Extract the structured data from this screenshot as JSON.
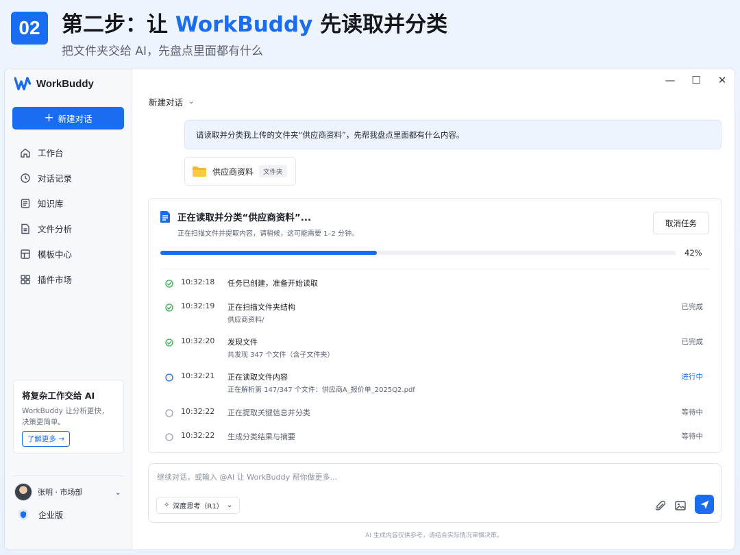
{
  "banner": {
    "step_number": "02",
    "title_prefix": "第二步：让 ",
    "title_brand": "WorkBuddy",
    "title_suffix": " 先读取并分类",
    "subtitle": "把文件夹交给 AI，先盘点里面都有什么"
  },
  "app": {
    "name": "WorkBuddy",
    "new_chat_label": "新建对话",
    "nav": [
      {
        "label": "工作台",
        "icon": "home-icon"
      },
      {
        "label": "对话记录",
        "icon": "clock-icon"
      },
      {
        "label": "知识库",
        "icon": "book-icon"
      },
      {
        "label": "文件分析",
        "icon": "file-icon"
      },
      {
        "label": "模板中心",
        "icon": "template-icon"
      },
      {
        "label": "插件市场",
        "icon": "grid-icon"
      }
    ],
    "promo": {
      "title": "将复杂工作交给 AI",
      "desc_line1": "WorkBuddy 让分析更快，",
      "desc_line2": "决策更简单。",
      "button": "了解更多 →"
    },
    "user": {
      "name": "张明 · 市场部"
    },
    "plan": "企业版"
  },
  "window_controls": {
    "minimize": "—",
    "maximize": "☐",
    "close": "✕"
  },
  "conversation": {
    "title": "新建对话",
    "user_message": "请读取并分类我上传的文件夹“供应商资料”，先帮我盘点里面都有什么内容。",
    "attachment": {
      "name": "供应商资料",
      "tag": "文件夹"
    }
  },
  "task": {
    "title": "正在读取并分类“供应商资料”...",
    "subtitle": "正在扫描文件并提取内容，请稍候，这可能需要 1–2 分钟。",
    "cancel_label": "取消任务",
    "progress": 42,
    "progress_label": "42%",
    "steps": [
      {
        "time": "10:32:18",
        "name": "任务已创建，准备开始读取",
        "detail": "",
        "status": "",
        "state": "done"
      },
      {
        "time": "10:32:19",
        "name": "正在扫描文件夹结构",
        "detail": "供应商资料/",
        "status": "已完成",
        "state": "done"
      },
      {
        "time": "10:32:20",
        "name": "发现文件",
        "detail": "共发现 347 个文件（含子文件夹）",
        "status": "已完成",
        "state": "done"
      },
      {
        "time": "10:32:21",
        "name": "正在读取文件内容",
        "detail": "正在解析第 147/347 个文件：供应商A_报价单_2025Q2.pdf",
        "status": "进行中",
        "state": "active"
      },
      {
        "time": "10:32:22",
        "name": "正在提取关键信息并分类",
        "detail": "",
        "status": "等待中",
        "state": "pending"
      },
      {
        "time": "10:32:22",
        "name": "生成分类结果与摘要",
        "detail": "",
        "status": "等待中",
        "state": "pending"
      }
    ]
  },
  "composer": {
    "placeholder": "继续对话，或输入 @AI 让 WorkBuddy 帮你做更多...",
    "mode_label": "深度思考（R1）",
    "disclaimer": "AI 生成内容仅供参考，请结合实际情况审慎决策。"
  },
  "colors": {
    "accent": "#1a6cf0",
    "success": "#2fb34a",
    "pending": "#9aa1ad"
  }
}
